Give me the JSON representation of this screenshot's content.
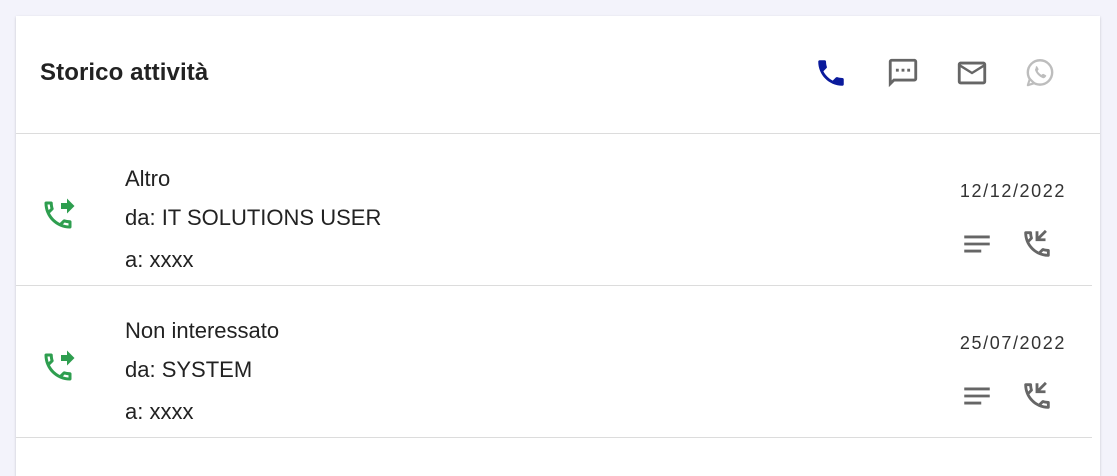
{
  "header": {
    "title": "Storico attività",
    "channels": [
      {
        "icon": "phone-icon",
        "color": "#1a237e",
        "active": true
      },
      {
        "icon": "sms-icon",
        "color": "#666666",
        "active": false
      },
      {
        "icon": "mail-icon",
        "color": "#666666",
        "active": false
      },
      {
        "icon": "whatsapp-icon",
        "color": "#bbbbbb",
        "active": false
      }
    ]
  },
  "activities": [
    {
      "direction_icon": "outgoing-call-icon",
      "outcome": "Altro",
      "from": "da: IT SOLUTIONS USER",
      "to": "a: xxxx",
      "date": "12/12/2022"
    },
    {
      "direction_icon": "outgoing-call-icon",
      "outcome": "Non interessato",
      "from": "da: SYSTEM",
      "to": "a: xxxx",
      "date": "25/07/2022"
    }
  ],
  "colors": {
    "accent": "#0a1a9c",
    "outgoing": "#2e9e4f",
    "icon_grey": "#666666",
    "disabled": "#bdbdbd"
  }
}
